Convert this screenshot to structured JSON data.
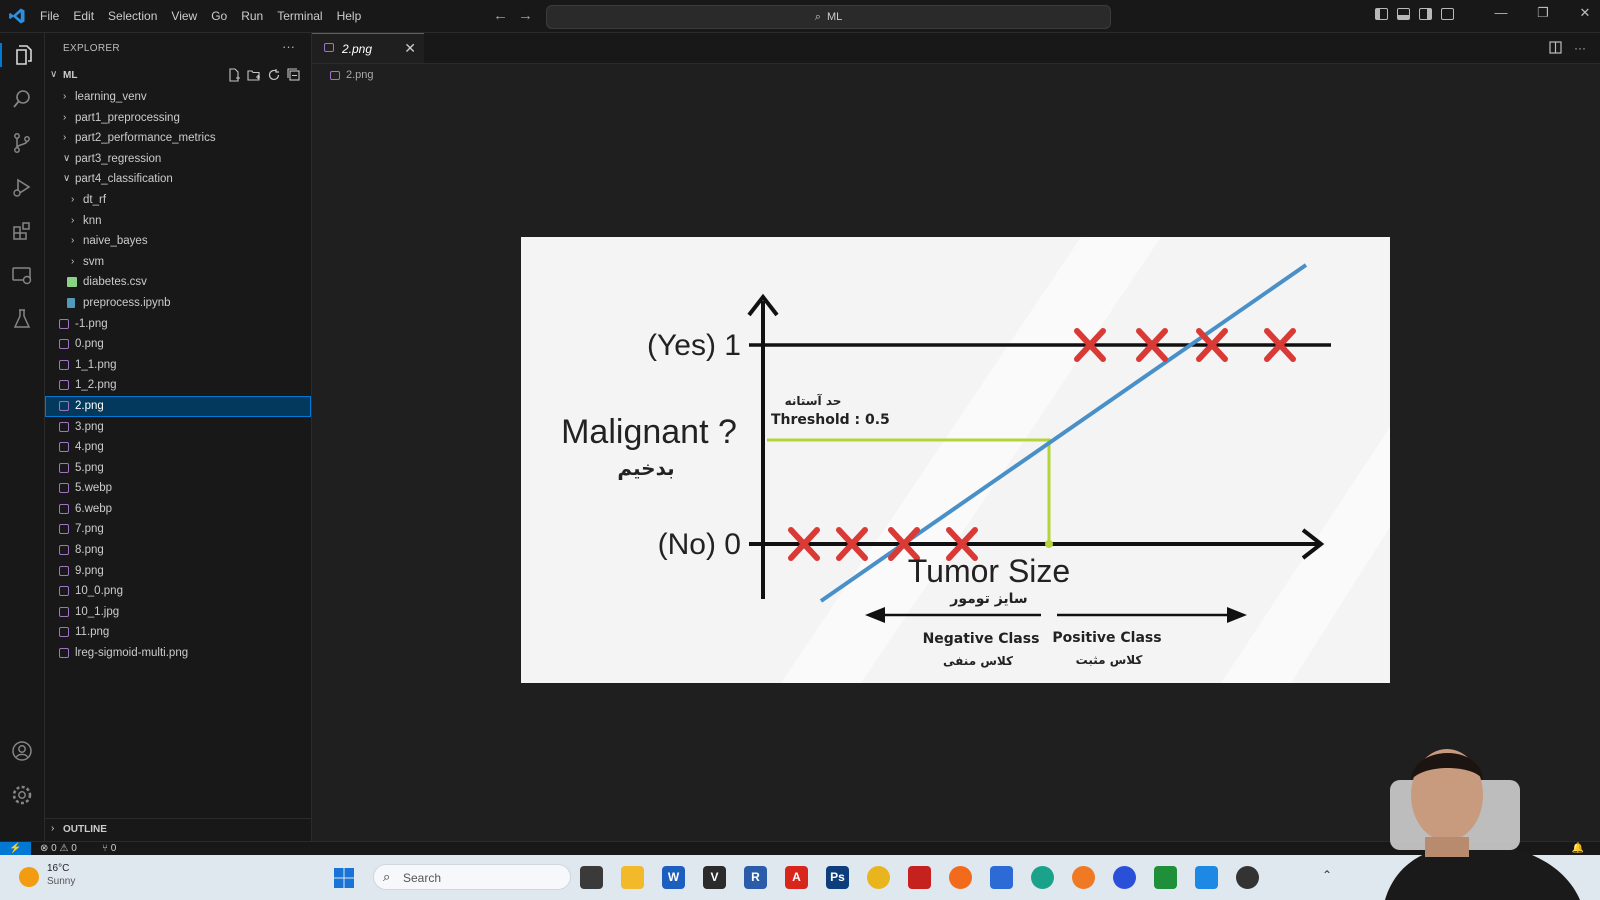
{
  "titlebar": {
    "menu": [
      "File",
      "Edit",
      "Selection",
      "View",
      "Go",
      "Run",
      "Terminal",
      "Help"
    ],
    "search_label": "ML",
    "window_controls": [
      "—",
      "❐",
      "✕"
    ]
  },
  "sidebar": {
    "title": "EXPLORER",
    "more": "···",
    "root": "ML",
    "tree": [
      {
        "label": "learning_venv",
        "type": "folder",
        "expanded": false,
        "depth": 0
      },
      {
        "label": "part1_preprocessing",
        "type": "folder",
        "expanded": false,
        "depth": 0
      },
      {
        "label": "part2_performance_metrics",
        "type": "folder",
        "expanded": false,
        "depth": 0
      },
      {
        "label": "part3_regression",
        "type": "folder",
        "expanded": true,
        "depth": 0
      },
      {
        "label": "part4_classification",
        "type": "folder",
        "expanded": true,
        "depth": 0
      },
      {
        "label": "dt_rf",
        "type": "folder",
        "expanded": false,
        "depth": 1
      },
      {
        "label": "knn",
        "type": "folder",
        "expanded": false,
        "depth": 1
      },
      {
        "label": "naive_bayes",
        "type": "folder",
        "expanded": false,
        "depth": 1
      },
      {
        "label": "svm",
        "type": "folder",
        "expanded": false,
        "depth": 1
      },
      {
        "label": "diabetes.csv",
        "type": "csv",
        "depth": 1
      },
      {
        "label": "preprocess.ipynb",
        "type": "notebook",
        "depth": 1
      },
      {
        "label": "-1.png",
        "type": "image",
        "depth": 0
      },
      {
        "label": "0.png",
        "type": "image",
        "depth": 0
      },
      {
        "label": "1_1.png",
        "type": "image",
        "depth": 0
      },
      {
        "label": "1_2.png",
        "type": "image",
        "depth": 0
      },
      {
        "label": "2.png",
        "type": "image",
        "depth": 0,
        "selected": true
      },
      {
        "label": "3.png",
        "type": "image",
        "depth": 0
      },
      {
        "label": "4.png",
        "type": "image",
        "depth": 0
      },
      {
        "label": "5.png",
        "type": "image",
        "depth": 0
      },
      {
        "label": "5.webp",
        "type": "image",
        "depth": 0
      },
      {
        "label": "6.webp",
        "type": "image",
        "depth": 0
      },
      {
        "label": "7.png",
        "type": "image",
        "depth": 0
      },
      {
        "label": "8.png",
        "type": "image",
        "depth": 0
      },
      {
        "label": "9.png",
        "type": "image",
        "depth": 0
      },
      {
        "label": "10_0.png",
        "type": "image",
        "depth": 0
      },
      {
        "label": "10_1.jpg",
        "type": "image",
        "depth": 0
      },
      {
        "label": "11.png",
        "type": "image",
        "depth": 0
      },
      {
        "label": "lreg-sigmoid-multi.png",
        "type": "image",
        "depth": 0
      }
    ],
    "outline": "OUTLINE"
  },
  "editor": {
    "tab_label": "2.png",
    "tab_close": "✕",
    "breadcrumb": "2.png"
  },
  "figure": {
    "yes_label": "(Yes) 1",
    "no_label": "(No) 0",
    "y_title": "Malignant ?",
    "y_title_fa": "بدخیم",
    "threshold_fa": "حد آستانه",
    "threshold": "Threshold : 0.5",
    "x_title": "Tumor Size",
    "x_title_fa": "سایز تومور",
    "neg_class": "Negative Class",
    "neg_class_fa": "کلاس منفی",
    "pos_class": "Positive Class",
    "pos_class_fa": "کلاس مثبت",
    "colors": {
      "line": "#4a90c8",
      "cross": "#d93a35",
      "threshold": "#b5d33a",
      "axis": "#111111"
    }
  },
  "statusbar": {
    "remote": "⚡",
    "problems": "⊗ 0 ⚠ 0",
    "ports": "⑂ 0"
  },
  "taskbar": {
    "temp": "16°C",
    "weather": "Sunny",
    "search": "Search"
  }
}
